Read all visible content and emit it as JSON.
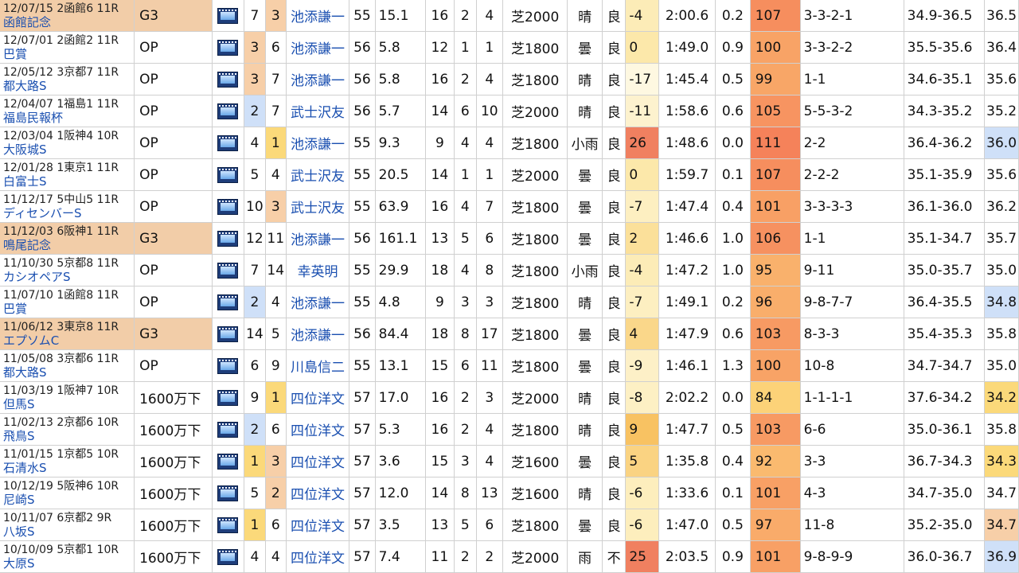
{
  "colors": {
    "grade_g3": "#f2cda8",
    "rank1": "#fbd97a",
    "rank23": "#f7cfa8",
    "blue_hl": "#cfe0f8",
    "link": "#1a4fb0"
  },
  "rows": [
    {
      "date": "12/07/15 2函館6 11R",
      "name": "函館記念",
      "grade": "G3",
      "gate": "7",
      "num": "3",
      "jockey": "池添謙一",
      "wt": "55",
      "odds": "15.1",
      "field": "16",
      "pop": "2",
      "fin": "4",
      "course": "芝2000",
      "weather": "晴",
      "cond": "良",
      "idx": "-4",
      "time": "2:00.6",
      "diff": "0.2",
      "score": "107",
      "pass": "3-3-2-1",
      "pace": "34.9-36.5",
      "last": "36.5"
    },
    {
      "date": "12/07/01 2函館2 11R",
      "name": "巴賞",
      "grade": "OP",
      "gate": "3",
      "num": "6",
      "jockey": "池添謙一",
      "wt": "56",
      "odds": "5.8",
      "field": "12",
      "pop": "1",
      "fin": "1",
      "course": "芝1800",
      "weather": "曇",
      "cond": "良",
      "idx": "0",
      "time": "1:49.0",
      "diff": "0.9",
      "score": "100",
      "pass": "3-3-2-2",
      "pace": "35.5-35.6",
      "last": "36.4"
    },
    {
      "date": "12/05/12 3京都7 11R",
      "name": "都大路S",
      "grade": "OP",
      "gate": "3",
      "num": "7",
      "jockey": "池添謙一",
      "wt": "56",
      "odds": "5.8",
      "field": "16",
      "pop": "2",
      "fin": "4",
      "course": "芝1800",
      "weather": "晴",
      "cond": "良",
      "idx": "-17",
      "time": "1:45.4",
      "diff": "0.5",
      "score": "99",
      "pass": "1-1",
      "pace": "34.6-35.1",
      "last": "35.6"
    },
    {
      "date": "12/04/07 1福島1 11R",
      "name": "福島民報杯",
      "grade": "OP",
      "gate": "2",
      "num": "7",
      "jockey": "武士沢友",
      "wt": "56",
      "odds": "5.7",
      "field": "14",
      "pop": "6",
      "fin": "10",
      "course": "芝2000",
      "weather": "晴",
      "cond": "良",
      "idx": "-11",
      "time": "1:58.6",
      "diff": "0.6",
      "score": "105",
      "pass": "5-5-3-2",
      "pace": "34.3-35.2",
      "last": "35.2"
    },
    {
      "date": "12/03/04 1阪神4 10R",
      "name": "大阪城S",
      "grade": "OP",
      "gate": "4",
      "num": "1",
      "jockey": "池添謙一",
      "wt": "55",
      "odds": "9.3",
      "field": "9",
      "pop": "4",
      "fin": "4",
      "course": "芝1800",
      "weather": "小雨",
      "cond": "良",
      "idx": "26",
      "time": "1:48.6",
      "diff": "0.0",
      "score": "111",
      "pass": "2-2",
      "pace": "36.4-36.2",
      "last": "36.0"
    },
    {
      "date": "12/01/28 1東京1 11R",
      "name": "白富士S",
      "grade": "OP",
      "gate": "5",
      "num": "4",
      "jockey": "武士沢友",
      "wt": "55",
      "odds": "20.5",
      "field": "14",
      "pop": "1",
      "fin": "1",
      "course": "芝2000",
      "weather": "曇",
      "cond": "良",
      "idx": "0",
      "time": "1:59.7",
      "diff": "0.1",
      "score": "107",
      "pass": "2-2-2",
      "pace": "35.1-35.9",
      "last": "35.6"
    },
    {
      "date": "11/12/17 5中山5 11R",
      "name": "ディセンバーS",
      "grade": "OP",
      "gate": "10",
      "num": "3",
      "jockey": "武士沢友",
      "wt": "55",
      "odds": "63.9",
      "field": "16",
      "pop": "4",
      "fin": "7",
      "course": "芝1800",
      "weather": "曇",
      "cond": "良",
      "idx": "-7",
      "time": "1:47.4",
      "diff": "0.4",
      "score": "101",
      "pass": "3-3-3-3",
      "pace": "36.1-36.0",
      "last": "36.2"
    },
    {
      "date": "11/12/03 6阪神1 11R",
      "name": "鳴尾記念",
      "grade": "G3",
      "gate": "12",
      "num": "11",
      "jockey": "池添謙一",
      "wt": "56",
      "odds": "161.1",
      "field": "13",
      "pop": "5",
      "fin": "6",
      "course": "芝1800",
      "weather": "曇",
      "cond": "良",
      "idx": "2",
      "time": "1:46.6",
      "diff": "1.0",
      "score": "106",
      "pass": "1-1",
      "pace": "35.1-34.7",
      "last": "35.7"
    },
    {
      "date": "11/10/30 5京都8 11R",
      "name": "カシオペアS",
      "grade": "OP",
      "gate": "7",
      "num": "14",
      "jockey": "幸英明",
      "wt": "55",
      "odds": "29.9",
      "field": "18",
      "pop": "4",
      "fin": "8",
      "course": "芝1800",
      "weather": "小雨",
      "cond": "良",
      "idx": "-4",
      "time": "1:47.2",
      "diff": "1.0",
      "score": "95",
      "pass": "9-11",
      "pace": "35.0-35.7",
      "last": "35.0"
    },
    {
      "date": "11/07/10 1函館8 11R",
      "name": "巴賞",
      "grade": "OP",
      "gate": "2",
      "num": "4",
      "jockey": "池添謙一",
      "wt": "55",
      "odds": "4.8",
      "field": "9",
      "pop": "3",
      "fin": "3",
      "course": "芝1800",
      "weather": "晴",
      "cond": "良",
      "idx": "-7",
      "time": "1:49.1",
      "diff": "0.2",
      "score": "96",
      "pass": "9-8-7-7",
      "pace": "36.4-35.5",
      "last": "34.8"
    },
    {
      "date": "11/06/12 3東京8 11R",
      "name": "エプソムC",
      "grade": "G3",
      "gate": "14",
      "num": "5",
      "jockey": "池添謙一",
      "wt": "56",
      "odds": "84.4",
      "field": "18",
      "pop": "8",
      "fin": "17",
      "course": "芝1800",
      "weather": "曇",
      "cond": "良",
      "idx": "4",
      "time": "1:47.9",
      "diff": "0.6",
      "score": "103",
      "pass": "8-3-3",
      "pace": "35.4-35.3",
      "last": "35.8"
    },
    {
      "date": "11/05/08 3京都6 11R",
      "name": "都大路S",
      "grade": "OP",
      "gate": "6",
      "num": "9",
      "jockey": "川島信二",
      "wt": "55",
      "odds": "13.1",
      "field": "15",
      "pop": "6",
      "fin": "11",
      "course": "芝1800",
      "weather": "曇",
      "cond": "良",
      "idx": "-9",
      "time": "1:46.1",
      "diff": "1.3",
      "score": "100",
      "pass": "10-8",
      "pace": "34.7-34.7",
      "last": "35.0"
    },
    {
      "date": "11/03/19 1阪神7 10R",
      "name": "但馬S",
      "grade": "1600万下",
      "gate": "9",
      "num": "1",
      "jockey": "四位洋文",
      "wt": "57",
      "odds": "17.0",
      "field": "16",
      "pop": "2",
      "fin": "3",
      "course": "芝2000",
      "weather": "晴",
      "cond": "良",
      "idx": "-8",
      "time": "2:02.2",
      "diff": "0.0",
      "score": "84",
      "pass": "1-1-1-1",
      "pace": "37.6-34.2",
      "last": "34.2"
    },
    {
      "date": "11/02/13 2京都6 10R",
      "name": "飛鳥S",
      "grade": "1600万下",
      "gate": "2",
      "num": "6",
      "jockey": "四位洋文",
      "wt": "57",
      "odds": "5.3",
      "field": "16",
      "pop": "2",
      "fin": "4",
      "course": "芝1800",
      "weather": "晴",
      "cond": "良",
      "idx": "9",
      "time": "1:47.7",
      "diff": "0.5",
      "score": "103",
      "pass": "6-6",
      "pace": "35.0-36.1",
      "last": "35.8"
    },
    {
      "date": "11/01/15 1京都5 10R",
      "name": "石清水S",
      "grade": "1600万下",
      "gate": "1",
      "num": "3",
      "jockey": "四位洋文",
      "wt": "57",
      "odds": "3.6",
      "field": "15",
      "pop": "3",
      "fin": "4",
      "course": "芝1600",
      "weather": "曇",
      "cond": "良",
      "idx": "5",
      "time": "1:35.8",
      "diff": "0.4",
      "score": "92",
      "pass": "3-3",
      "pace": "36.7-34.3",
      "last": "34.3"
    },
    {
      "date": "10/12/19 5阪神6 10R",
      "name": "尼崎S",
      "grade": "1600万下",
      "gate": "5",
      "num": "2",
      "jockey": "四位洋文",
      "wt": "57",
      "odds": "12.0",
      "field": "14",
      "pop": "8",
      "fin": "13",
      "course": "芝1600",
      "weather": "晴",
      "cond": "良",
      "idx": "-6",
      "time": "1:33.6",
      "diff": "0.1",
      "score": "101",
      "pass": "4-3",
      "pace": "34.7-35.0",
      "last": "34.7"
    },
    {
      "date": "10/11/07 6京都2 9R",
      "name": "八坂S",
      "grade": "1600万下",
      "gate": "1",
      "num": "6",
      "jockey": "四位洋文",
      "wt": "57",
      "odds": "3.5",
      "field": "13",
      "pop": "5",
      "fin": "6",
      "course": "芝1800",
      "weather": "曇",
      "cond": "良",
      "idx": "-6",
      "time": "1:47.0",
      "diff": "0.5",
      "score": "97",
      "pass": "11-8",
      "pace": "35.2-35.0",
      "last": "34.7"
    },
    {
      "date": "10/10/09 5京都1 10R",
      "name": "大原S",
      "grade": "1600万下",
      "gate": "4",
      "num": "4",
      "jockey": "四位洋文",
      "wt": "57",
      "odds": "7.4",
      "field": "11",
      "pop": "2",
      "fin": "2",
      "course": "芝2000",
      "weather": "雨",
      "cond": "不",
      "idx": "25",
      "time": "2:03.5",
      "diff": "0.9",
      "score": "101",
      "pass": "9-8-9-9",
      "pace": "36.0-36.7",
      "last": "36.9"
    }
  ]
}
